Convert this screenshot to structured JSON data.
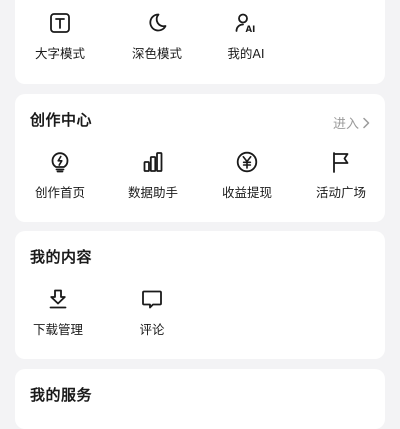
{
  "top_items": [
    {
      "label": "大字模式",
      "icon": "large-text-icon"
    },
    {
      "label": "深色模式",
      "icon": "moon-icon"
    },
    {
      "label": "我的AI",
      "icon": "user-ai-icon"
    }
  ],
  "creation_center": {
    "title": "创作中心",
    "enter_label": "进入",
    "items": [
      {
        "label": "创作首页",
        "icon": "lightning-bulb-icon"
      },
      {
        "label": "数据助手",
        "icon": "bar-chart-icon"
      },
      {
        "label": "收益提现",
        "icon": "yuan-icon"
      },
      {
        "label": "活动广场",
        "icon": "flag-icon"
      }
    ]
  },
  "my_content": {
    "title": "我的内容",
    "items": [
      {
        "label": "下载管理",
        "icon": "download-icon"
      },
      {
        "label": "评论",
        "icon": "comment-icon"
      }
    ]
  },
  "my_services": {
    "title": "我的服务"
  }
}
